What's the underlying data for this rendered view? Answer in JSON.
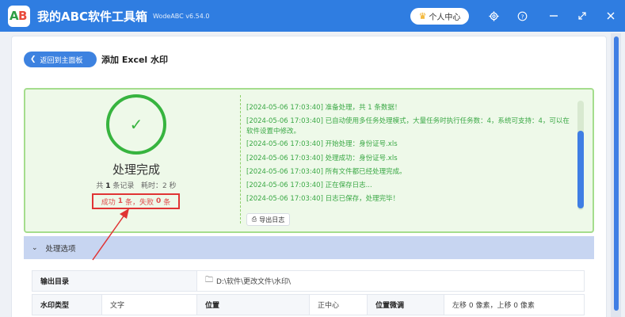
{
  "app": {
    "title": "我的ABC软件工具箱",
    "version": "WodeABC v6.54.0",
    "user_center": "个人中心",
    "logo_letters": [
      "A",
      "B"
    ]
  },
  "titlebar_icons": [
    "settings-icon",
    "help-icon",
    "minimize-icon",
    "close-icon"
  ],
  "nav": {
    "back_label": "返回到主面板",
    "page_title": "添加 Excel 水印"
  },
  "result": {
    "status_title": "处理完成",
    "stats_prefix": "共",
    "stats_count": "1",
    "stats_mid": "条记录",
    "stats_time_label": "耗时：",
    "stats_time": "2 秒",
    "success_label": "成功",
    "success_count": "1",
    "success_unit": "条，失败",
    "fail_count": "0",
    "fail_unit": "条"
  },
  "log": {
    "lines": [
      "[2024-05-06 17:03:40] 准备处理，共 1 条数据！",
      "[2024-05-06 17:03:40] 已自动使用多任务处理模式，大量任务时执行任务数：4，系统可支持：4，可以在软件设置中修改。",
      "[2024-05-06 17:03:40] 开始处理：身份证号.xls",
      "[2024-05-06 17:03:40] 处理成功：身份证号.xls",
      "[2024-05-06 17:03:40] 所有文件都已经处理完成。",
      "[2024-05-06 17:03:40] 正在保存日志...",
      "[2024-05-06 17:03:40] 日志已保存，处理完毕！"
    ],
    "export_label": "导出日志"
  },
  "options": {
    "header": "处理选项",
    "output_dir_label": "输出目录",
    "output_dir_value": "D:\\软件\\更改文件\\水印\\",
    "watermark_type_label": "水印类型",
    "watermark_type_value": "文字",
    "position_label": "位置",
    "position_value": "正中心",
    "fine_tune_label": "位置微调",
    "fine_tune_value": "左移 0 像素，上移 0 像素"
  },
  "colors": {
    "titlebar": "#2f7de1",
    "success_green": "#37b43f",
    "log_green": "#3aa845",
    "highlight_red": "#e03434"
  }
}
